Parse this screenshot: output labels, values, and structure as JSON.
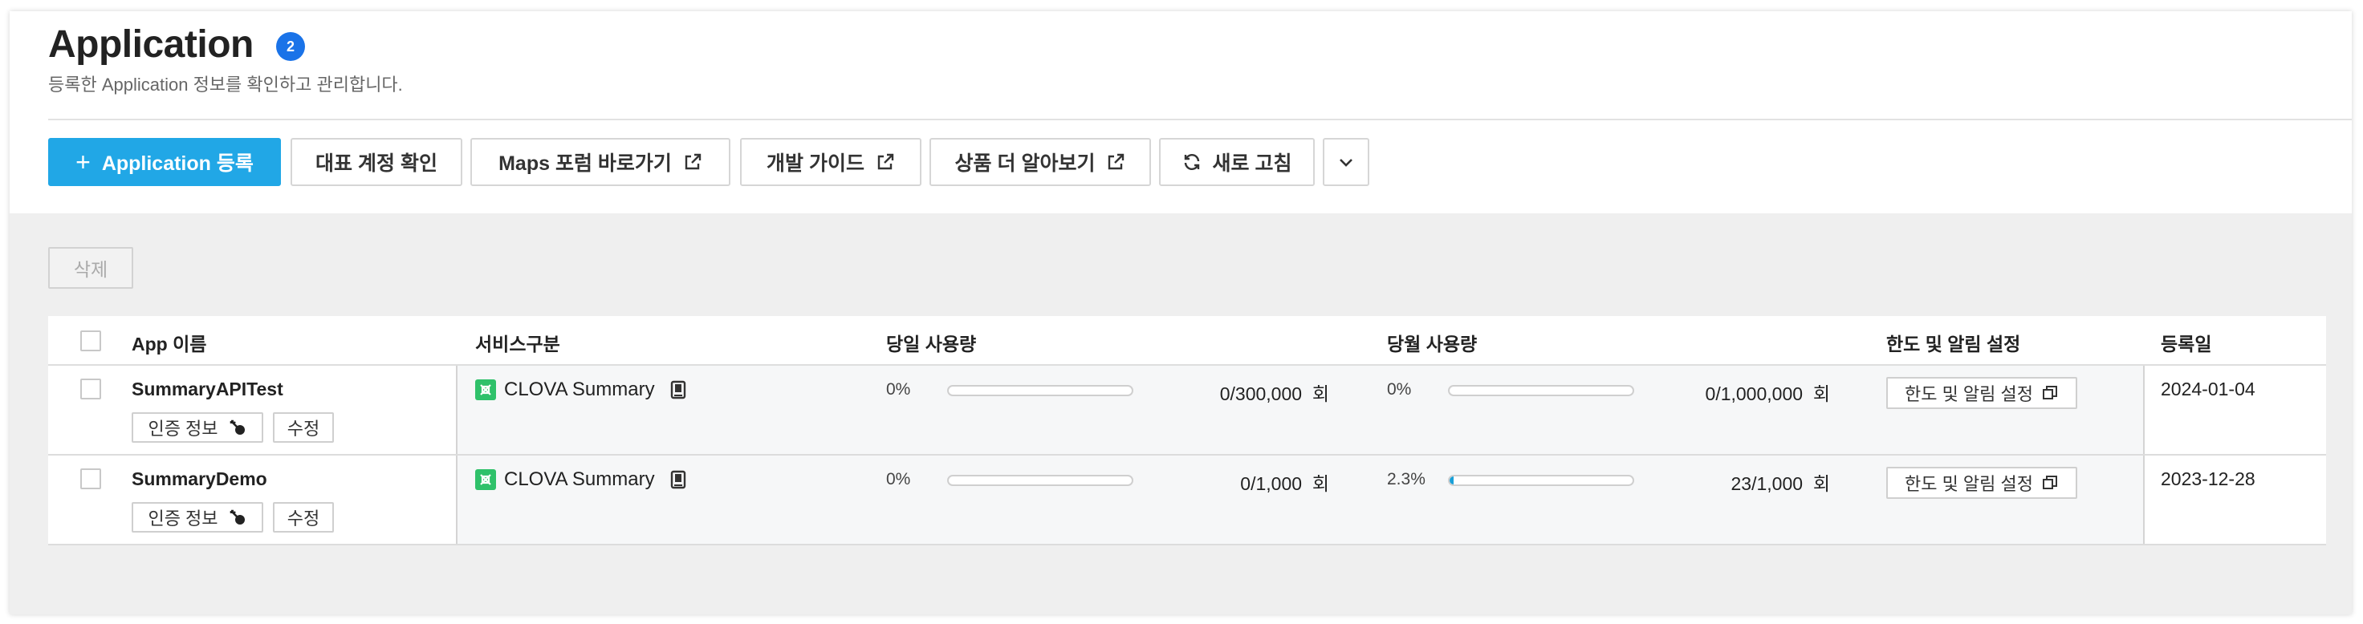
{
  "header": {
    "title": "Application",
    "count_badge": "2",
    "subtitle": "등록한 Application 정보를 확인하고 관리합니다."
  },
  "toolbar": {
    "register_label": "Application 등록",
    "account_label": "대표 계정 확인",
    "forum_label": "Maps 포럼 바로가기",
    "guide_label": "개발 가이드",
    "product_label": "상품 더 알아보기",
    "refresh_label": "새로 고침",
    "accent_color": "#21a7e6"
  },
  "delete_label": "삭제",
  "table": {
    "columns": [
      "App 이름",
      "서비스구분",
      "당일 사용량",
      "당월 사용량",
      "한도 및 알림 설정",
      "등록일"
    ],
    "auth_label": "인증 정보",
    "edit_label": "수정",
    "rows": [
      {
        "name": "SummaryAPITest",
        "service": "CLOVA Summary",
        "daily_pct": "0%",
        "daily_fraction": 0,
        "daily_usage": "0/300,000",
        "daily_unit": "회",
        "monthly_pct": "0%",
        "monthly_fraction": 0,
        "monthly_usage": "0/1,000,000",
        "monthly_unit": "회",
        "limit_label": "한도 및 알림 설정",
        "date": "2024-01-04"
      },
      {
        "name": "SummaryDemo",
        "service": "CLOVA Summary",
        "daily_pct": "0%",
        "daily_fraction": 0,
        "daily_usage": "0/1,000",
        "daily_unit": "회",
        "monthly_pct": "2.3%",
        "monthly_fraction": 0.023,
        "monthly_usage": "23/1,000",
        "monthly_unit": "회",
        "limit_label": "한도 및 알림 설정",
        "date": "2023-12-28"
      }
    ]
  }
}
